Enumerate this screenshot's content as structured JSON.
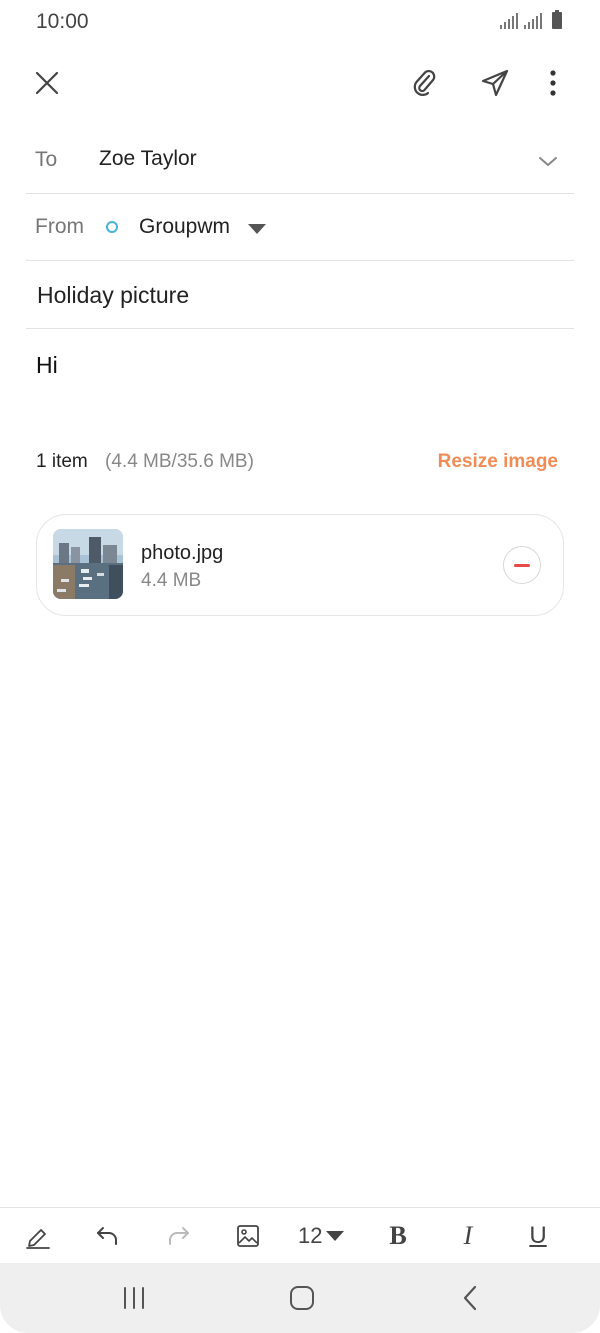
{
  "status_bar": {
    "time": "10:00"
  },
  "toolbar": {
    "close_icon": "close-icon",
    "attach_icon": "paperclip-icon",
    "send_icon": "send-icon",
    "more_icon": "more-vertical-icon"
  },
  "compose": {
    "to_label": "To",
    "to_value": "Zoe Taylor",
    "from_label": "From",
    "from_value": "Groupwm",
    "subject": "Holiday picture",
    "body": "Hi"
  },
  "attachments": {
    "count_text": "1 item",
    "size_text": "(4.4 MB/35.6 MB)",
    "resize_label": "Resize image",
    "items": [
      {
        "name": "photo.jpg",
        "size": "4.4 MB"
      }
    ]
  },
  "format_bar": {
    "font_size": "12",
    "bold_label": "B",
    "italic_label": "I",
    "underline_label": "U"
  },
  "colors": {
    "accent": "#f08d56",
    "account_dot": "#44b4dc",
    "remove": "#e84a4a"
  }
}
